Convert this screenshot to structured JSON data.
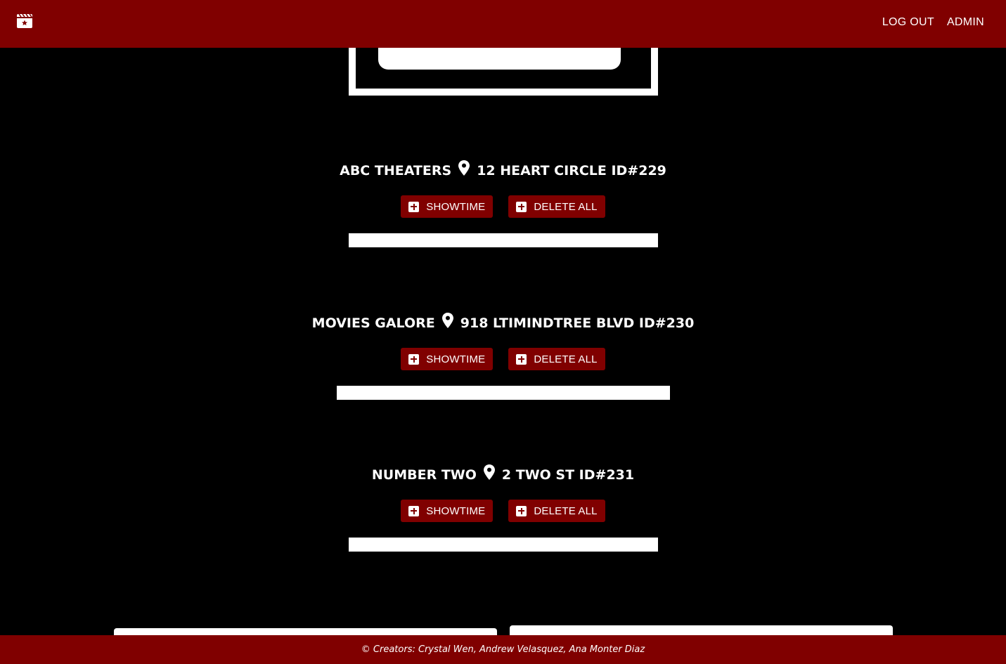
{
  "nav": {
    "logo_icon": "film-clapper-icon",
    "logout_label": "LOG OUT",
    "admin_label": "ADMIN"
  },
  "theaters": [
    {
      "name": "ABC THEATERS",
      "address": "12 HEART CIRCLE ID#229",
      "showtime_label": "SHOWTIME",
      "delete_label": "DELETE ALL"
    },
    {
      "name": "MOVIES GALORE",
      "address": "918 LTIMINDTREE BLVD ID#230",
      "showtime_label": "SHOWTIME",
      "delete_label": "DELETE ALL"
    },
    {
      "name": "NUMBER TWO",
      "address": "2 TWO ST ID#231",
      "showtime_label": "SHOWTIME",
      "delete_label": "DELETE ALL"
    }
  ],
  "footer": {
    "text": "© Creators: Crystal Wen, Andrew Velasquez, Ana Monter Diaz"
  },
  "colors": {
    "brand": "#800000",
    "background": "#000000",
    "text": "#ffffff"
  }
}
